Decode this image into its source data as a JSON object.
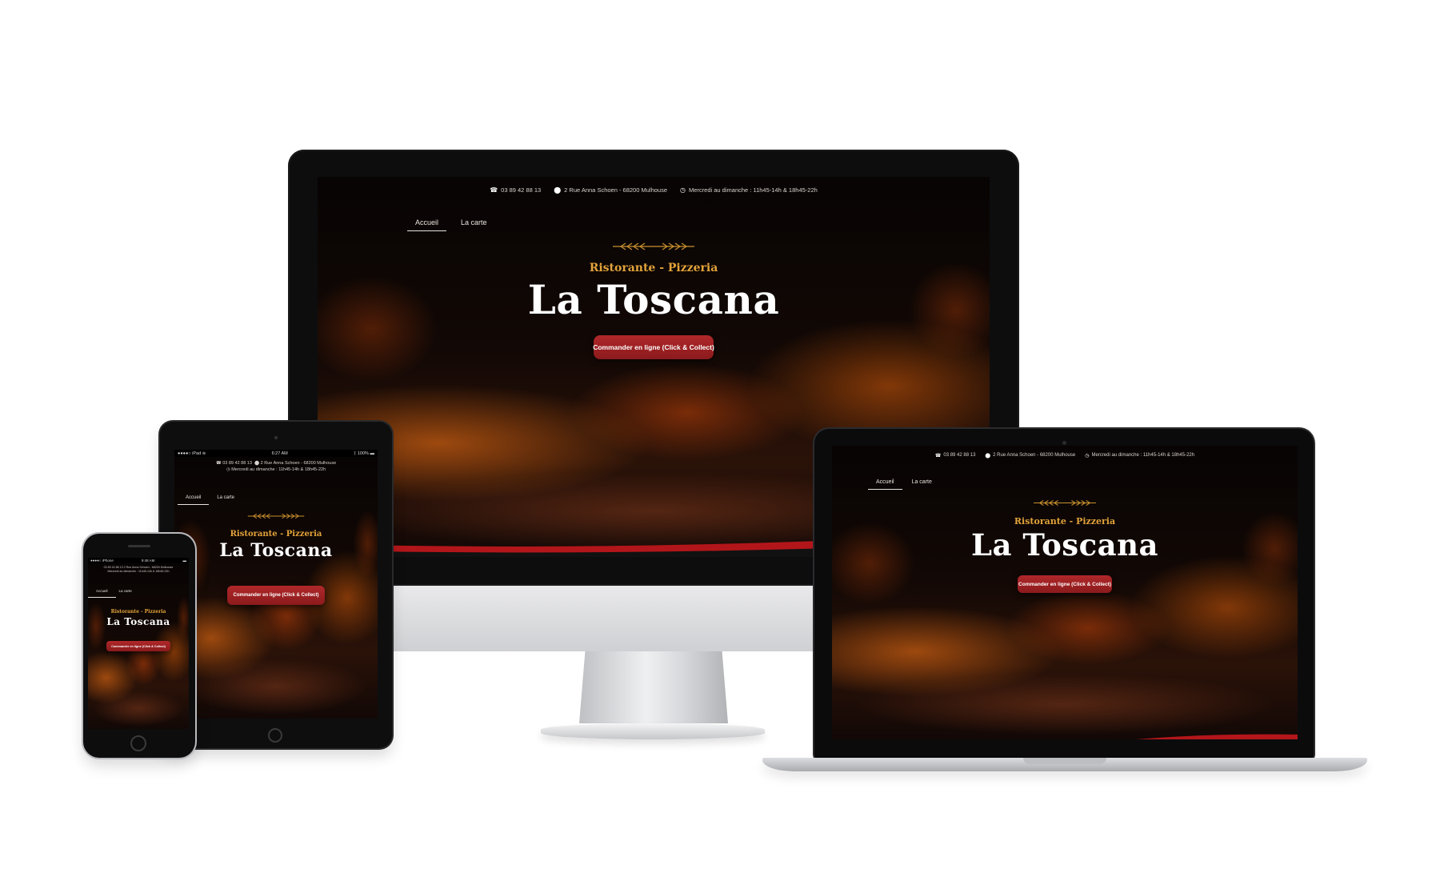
{
  "site": {
    "phone": "03 89 42 88 13",
    "address": "2 Rue Anna Schoen - 68200 Mulhouse",
    "hours": "Mercredi au dimanche : 11h45-14h & 18h45-22h",
    "nav": [
      "Accueil",
      "La carte"
    ],
    "subtitle": "Ristorante - Pizzeria",
    "title": "La Toscana",
    "cta": "Commander en ligne (Click & Collect)"
  },
  "tablet_status": {
    "carrier": "iPad",
    "time": "6:27 AM",
    "battery": "100%"
  },
  "phone_status": {
    "carrier": "iPhone",
    "time": "9:48 AM"
  },
  "colors": {
    "accent_gold": "#e3a33a",
    "button_red": "#a82224",
    "background_dark": "#0a0605"
  },
  "icons": [
    "phone-icon",
    "location-pin-icon",
    "clock-icon",
    "laurel-ornament-icon",
    "wifi-icon",
    "bluetooth-icon",
    "battery-icon"
  ]
}
